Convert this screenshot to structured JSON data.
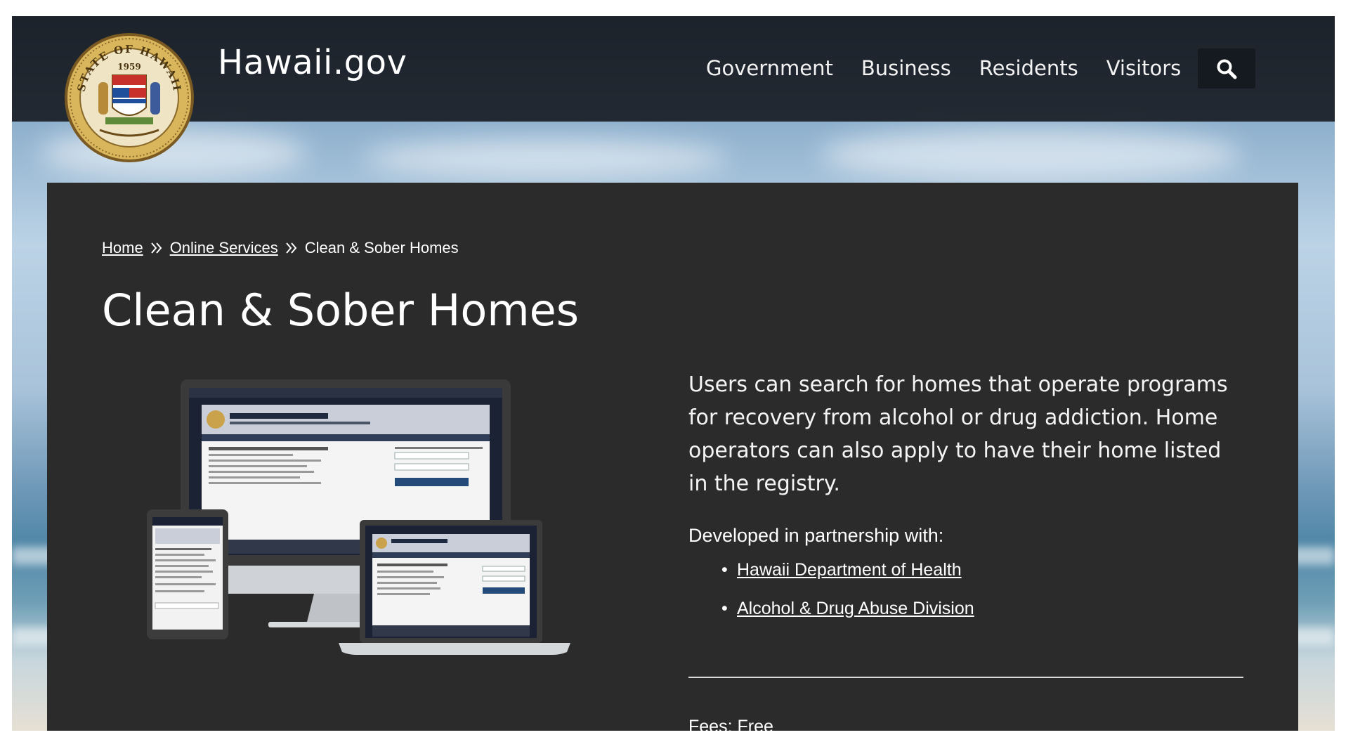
{
  "header": {
    "site_title": "Hawaii.gov",
    "seal": {
      "top_text": "STATE OF HAWAII",
      "year": "1959"
    },
    "nav": [
      {
        "label": "Government"
      },
      {
        "label": "Business"
      },
      {
        "label": "Residents"
      },
      {
        "label": "Visitors"
      }
    ],
    "search_icon": "search-icon"
  },
  "breadcrumb": {
    "home": "Home",
    "online_services": "Online Services",
    "current": "Clean & Sober Homes"
  },
  "page": {
    "title": "Clean & Sober Homes",
    "description": "Users can search for homes that operate programs for recovery from alcohol or drug addiction. Home operators can also apply to have their home listed in the registry.",
    "partner_heading": "Developed in partnership with:",
    "partners": [
      {
        "label": "Hawaii Department of Health"
      },
      {
        "label": "Alcohol & Drug Abuse Division"
      }
    ],
    "fees": "Fees: Free"
  },
  "colors": {
    "header_bg": "#161b21",
    "panel_bg": "#2b2b2b",
    "seal_gold": "#c9a04a",
    "text": "#ffffff"
  }
}
